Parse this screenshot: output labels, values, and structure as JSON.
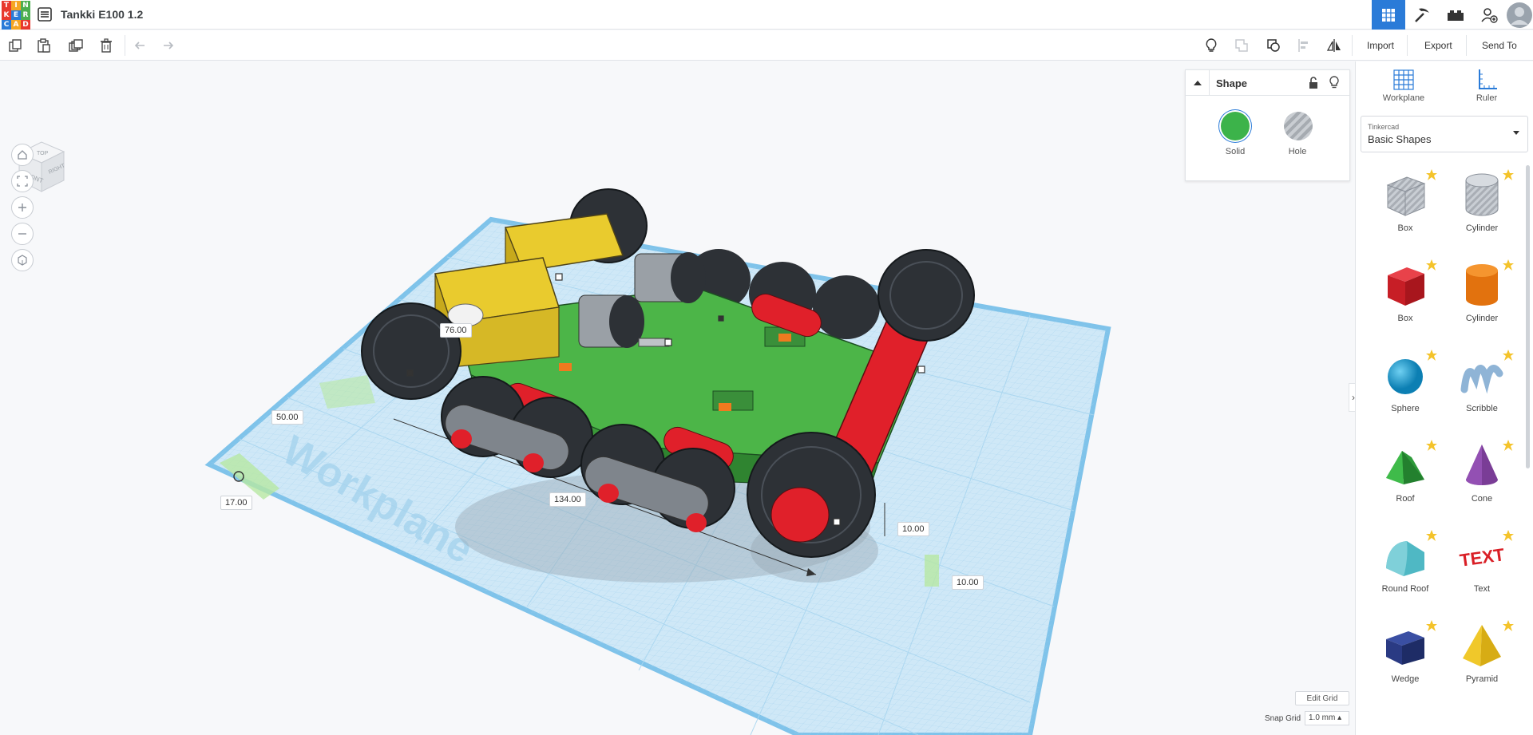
{
  "app": {
    "logo_letters": [
      "T",
      "I",
      "N",
      "K",
      "E",
      "R",
      "C",
      "A",
      "D"
    ],
    "logo_colors": [
      "#e8382d",
      "#f6a623",
      "#4caf50",
      "#e8382d",
      "#2a7bd8",
      "#4caf50",
      "#2a7bd8",
      "#f6a623",
      "#e8382d"
    ],
    "document_title": "Tankki E100 1.2"
  },
  "toolbar": {
    "import_label": "Import",
    "export_label": "Export",
    "send_to_label": "Send To"
  },
  "viewcube": {
    "top": "TOP",
    "front": "FRONT",
    "right": "RIGHT"
  },
  "inspector": {
    "title": "Shape",
    "solid_label": "Solid",
    "hole_label": "Hole",
    "solid_color": "#3cb34a"
  },
  "right_panel": {
    "workplane_label": "Workplane",
    "ruler_label": "Ruler",
    "library_category": "Tinkercad",
    "library_name": "Basic Shapes",
    "shapes": [
      {
        "label": "Box",
        "kind": "box-hole"
      },
      {
        "label": "Cylinder",
        "kind": "cyl-hole"
      },
      {
        "label": "Box",
        "kind": "box-red"
      },
      {
        "label": "Cylinder",
        "kind": "cyl-orange"
      },
      {
        "label": "Sphere",
        "kind": "sphere"
      },
      {
        "label": "Scribble",
        "kind": "scribble"
      },
      {
        "label": "Roof",
        "kind": "roof"
      },
      {
        "label": "Cone",
        "kind": "cone"
      },
      {
        "label": "Round Roof",
        "kind": "roundroof"
      },
      {
        "label": "Text",
        "kind": "text"
      },
      {
        "label": "Wedge",
        "kind": "wedge"
      },
      {
        "label": "Pyramid",
        "kind": "pyramid"
      }
    ]
  },
  "dimensions": {
    "height_top": "76.00",
    "width_left": "50.00",
    "offset_left": "17.00",
    "length": "134.00",
    "elevation": "10.00",
    "depth": "10.00"
  },
  "workplane_text": "Workplane",
  "grid": {
    "edit_grid_label": "Edit Grid",
    "snap_grid_label": "Snap Grid",
    "snap_grid_value": "1.0 mm"
  }
}
